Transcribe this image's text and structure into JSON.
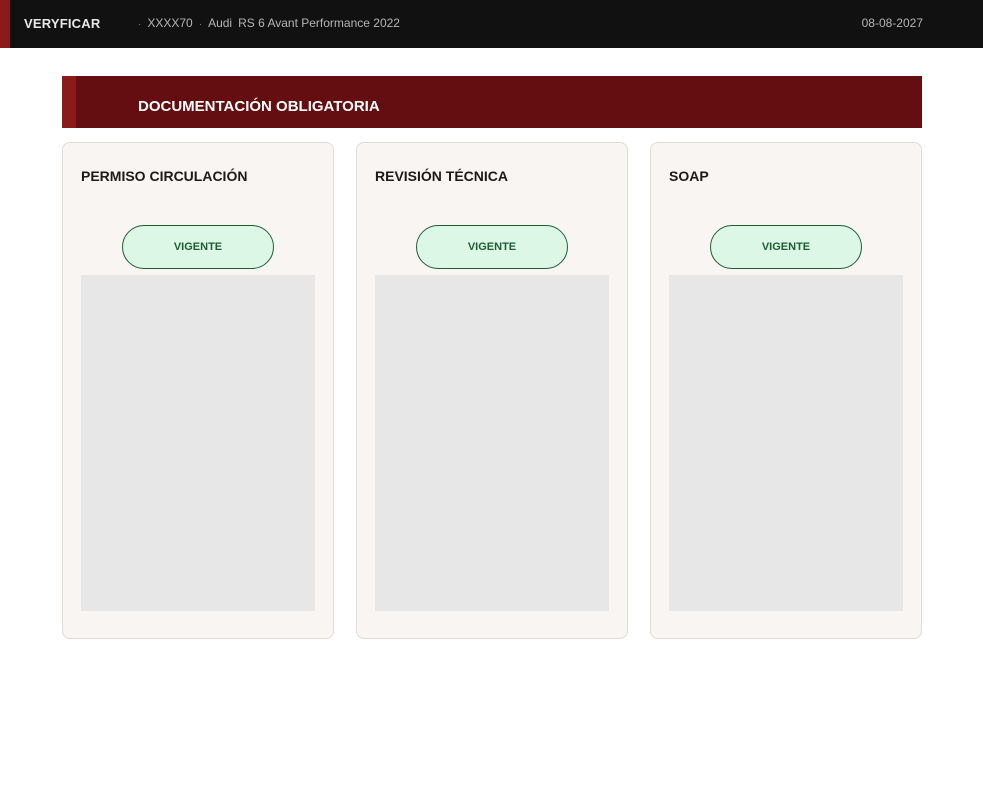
{
  "header": {
    "brand": "VERYFICAR",
    "separator": "·",
    "plate": "XXXX70",
    "make": "Audi",
    "model": "RS 6 Avant Performance 2022",
    "date": "08-08-2027"
  },
  "section": {
    "title": "DOCUMENTACIÓN OBLIGATORIA"
  },
  "cards": [
    {
      "title": "PERMISO CIRCULACIÓN",
      "status": "VIGENTE"
    },
    {
      "title": "REVISIÓN TÉCNICA",
      "status": "VIGENTE"
    },
    {
      "title": "SOAP",
      "status": "VIGENTE"
    }
  ],
  "colors": {
    "topbar": "#111111",
    "accent": "#8b1a1a",
    "section_header": "#650e12",
    "card_background": "#f9f5f2",
    "status_valid_bg": "#dcf7e6",
    "status_valid_text": "#1e5c34",
    "preview_placeholder": "#e7e7e7"
  }
}
